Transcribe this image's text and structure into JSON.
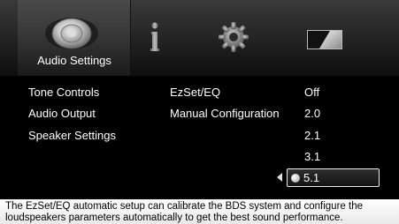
{
  "tabs": {
    "audio_settings": {
      "label": "Audio Settings",
      "icon": "speaker-icon"
    },
    "info": {
      "icon": "info-icon"
    },
    "settings": {
      "icon": "gear-icon"
    },
    "display": {
      "icon": "display-icon"
    }
  },
  "menu": {
    "categories": [
      "Tone Controls",
      "Audio Output",
      "Speaker Settings"
    ],
    "settings": [
      "EzSet/EQ",
      "Manual Configuration"
    ],
    "options": [
      "Off",
      "2.0",
      "2.1",
      "3.1"
    ],
    "selected_option": "5.1"
  },
  "help_text": "The EzSet/EQ automatic setup can calibrate the BDS system and configure the loudspeakers parameters automatically to get the best sound performance.",
  "colors": {
    "background": "#000000",
    "text": "#ffffff",
    "help_bar": "#f2f2f2"
  }
}
